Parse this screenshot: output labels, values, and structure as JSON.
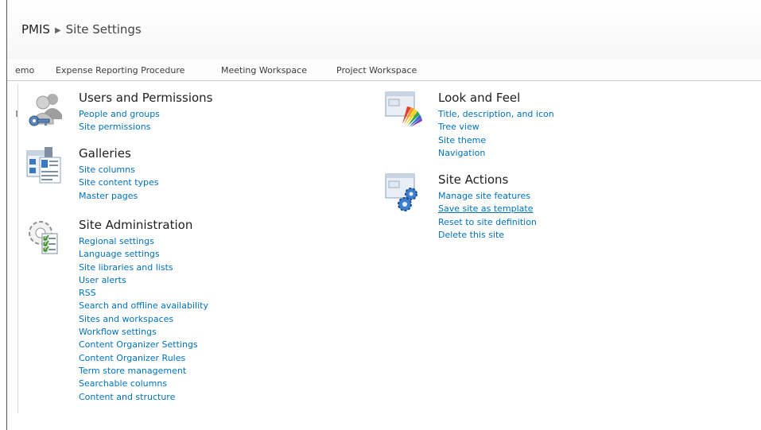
{
  "breadcrumb": {
    "site": "PMIS",
    "current": "Site Settings"
  },
  "nav": [
    "emo",
    "Expense Reporting Procedure",
    "Meeting Workspace",
    "Project Workspace"
  ],
  "groups": {
    "users": {
      "title": "Users and Permissions",
      "links": [
        "People and groups",
        "Site permissions"
      ],
      "icon": "users-keys-icon"
    },
    "galleries": {
      "title": "Galleries",
      "links": [
        "Site columns",
        "Site content types",
        "Master pages"
      ],
      "icon": "galleries-icon"
    },
    "admin": {
      "title": "Site Administration",
      "links": [
        "Regional settings",
        "Language settings",
        "Site libraries and lists",
        "User alerts",
        "RSS",
        "Search and offline availability",
        "Sites and workspaces",
        "Workflow settings",
        "Content Organizer Settings",
        "Content Organizer Rules",
        "Term store management",
        "Searchable columns",
        "Content and structure"
      ],
      "icon": "gear-checklist-icon"
    },
    "look": {
      "title": "Look and Feel",
      "links": [
        "Title, description, and icon",
        "Tree view",
        "Site theme",
        "Navigation"
      ],
      "icon": "color-swatch-icon"
    },
    "actions": {
      "title": "Site Actions",
      "links": [
        "Manage site features",
        "Save site as template",
        "Reset to site definition",
        "Delete this site"
      ],
      "icon": "window-gears-icon"
    }
  },
  "colors": {
    "link": "#0072bc",
    "heading": "#1f1f1f"
  }
}
